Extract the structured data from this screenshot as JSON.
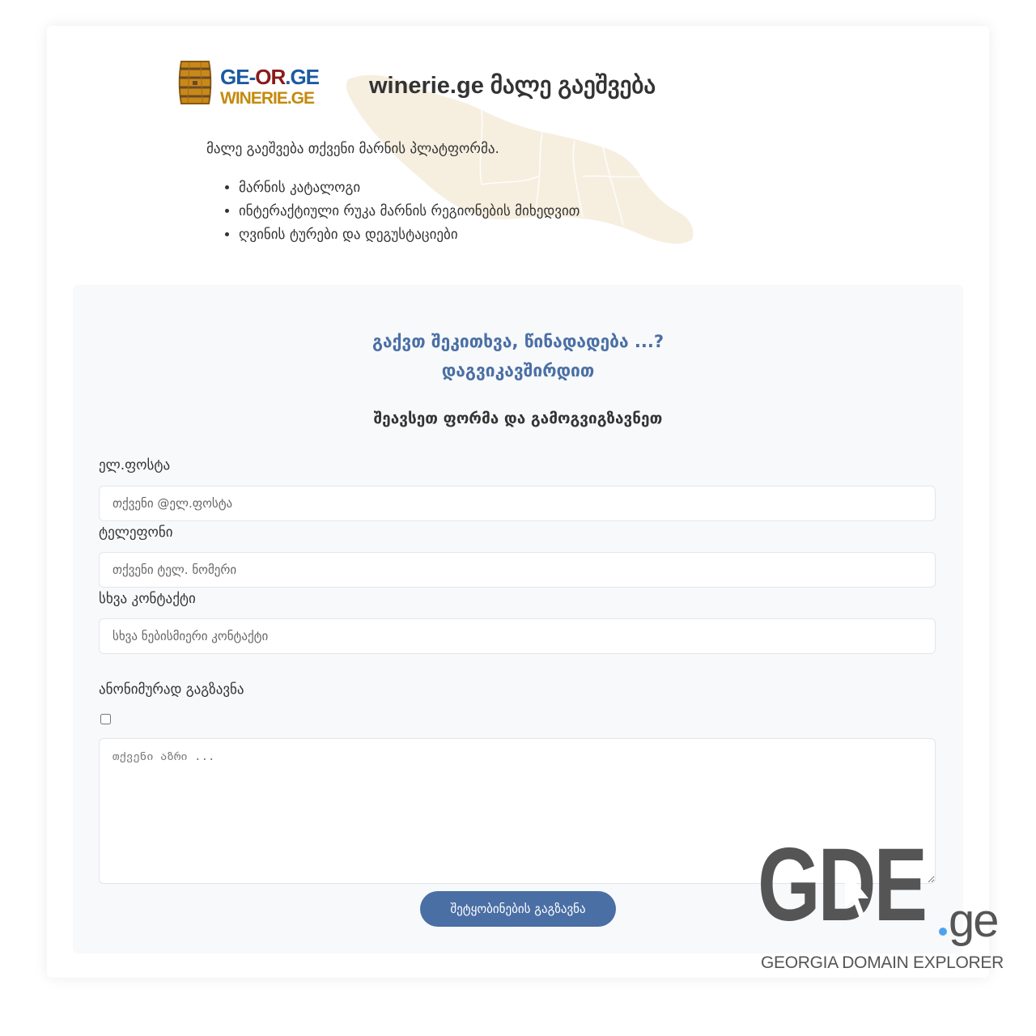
{
  "logo": {
    "line1": [
      "GE-",
      "OR",
      ".GE"
    ],
    "line2": "WINERIE.GE",
    "colors": {
      "blue": "#1a5aa0",
      "red": "#8b1a1a",
      "gold": "#c48a0d"
    }
  },
  "header": {
    "headline": "winerie.ge მალე გაეშვება"
  },
  "intro": {
    "text": "მალე გაეშვება თქვენი მარნის პლატფორმა.",
    "features": [
      "მარნის კატალოგი",
      "ინტერაქტიული რუკა მარნის რეგიონების მიხედვით",
      "ღვინის ტურები და დეგუსტაციები"
    ]
  },
  "contact": {
    "title_line1": "გაქვთ შეკითხვა, წინადადება ...?",
    "title_line2": "დაგვიკავშირდით",
    "subtitle": "შეავსეთ ფორმა და გამოგვიგზავნეთ",
    "email": {
      "label": "ელ.ფოსტა",
      "placeholder": "თქვენი @ელ.ფოსტა",
      "value": ""
    },
    "phone": {
      "label": "ტელეფონი",
      "placeholder": "თქვენი ტელ. ნომერი",
      "value": ""
    },
    "other": {
      "label": "სხვა კონტაქტი",
      "placeholder": "სხვა ნებისმიერი კონტაქტი",
      "value": ""
    },
    "anonymous": {
      "label": "ანონიმურად გაგზავნა",
      "checked": false
    },
    "message": {
      "placeholder": "თქვენი აზრი ...",
      "value": ""
    },
    "submit_label": "შეტყობინების გაგზავნა",
    "accent_color": "#4a6fa5"
  },
  "watermark": {
    "brand": "GDE",
    "tld": "ge",
    "tagline": "GEORGIA DOMAIN EXPLORER"
  }
}
